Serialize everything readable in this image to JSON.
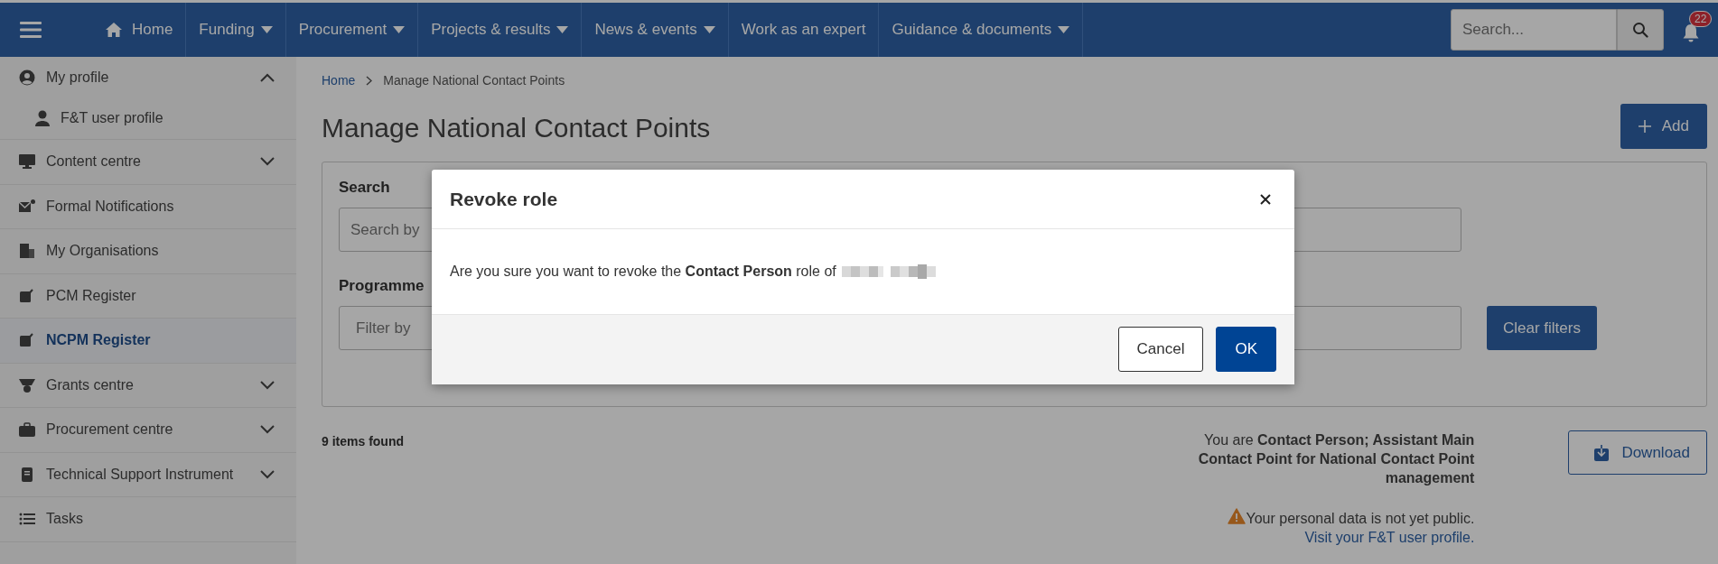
{
  "nav": {
    "items": [
      {
        "label": "Home",
        "kind": "home",
        "dropdown": false
      },
      {
        "label": "Funding",
        "kind": "link",
        "dropdown": true
      },
      {
        "label": "Procurement",
        "kind": "link",
        "dropdown": true
      },
      {
        "label": "Projects & results",
        "kind": "link",
        "dropdown": true
      },
      {
        "label": "News & events",
        "kind": "link",
        "dropdown": true
      },
      {
        "label": "Work as an expert",
        "kind": "link",
        "dropdown": false
      },
      {
        "label": "Guidance & documents",
        "kind": "link",
        "dropdown": true
      }
    ],
    "search": {
      "placeholder": "Search..."
    },
    "notifications": "22"
  },
  "sidebar": {
    "items": [
      {
        "label": "My profile",
        "kind": "group",
        "expanded": true,
        "selected": false,
        "children": [
          {
            "label": "F&T user profile",
            "selected": false
          }
        ]
      },
      {
        "label": "Content centre",
        "kind": "group",
        "expanded": false,
        "selected": false
      },
      {
        "label": "Formal Notifications",
        "kind": "link",
        "selected": false
      },
      {
        "label": "My Organisations",
        "kind": "link",
        "selected": false
      },
      {
        "label": "PCM Register",
        "kind": "link",
        "selected": false
      },
      {
        "label": "NCPM Register",
        "kind": "link",
        "selected": true
      },
      {
        "label": "Grants centre",
        "kind": "group",
        "expanded": false,
        "selected": false
      },
      {
        "label": "Procurement centre",
        "kind": "group",
        "expanded": false,
        "selected": false
      },
      {
        "label": "Technical Support Instrument",
        "kind": "group",
        "expanded": false,
        "selected": false
      },
      {
        "label": "Tasks",
        "kind": "link",
        "selected": false
      }
    ]
  },
  "breadcrumb": [
    "Home",
    "Manage National Contact Points"
  ],
  "page_title": "Manage National Contact Points",
  "add_button": "Add",
  "filters": {
    "search_label": "Search",
    "search_placeholder": "Search by",
    "programme_label": "Programme",
    "programme_placeholder": "Filter by",
    "clear_button": "Clear filters"
  },
  "results": {
    "count": "9 items found",
    "role_text": "You are **Contact Person; Assistant Main Contact Point for National Contact Point management**",
    "notice": "Your personal data is not yet public.",
    "notice_link": "Visit your F&T user profile.",
    "download_button": "Download"
  },
  "dialog": {
    "title": "Revoke role",
    "message": "Are you sure you want to revoke the **Contact Person** role of",
    "buttons": [
      {
        "label": "Cancel",
        "kind": "secondary"
      },
      {
        "label": "OK",
        "kind": "primary"
      }
    ]
  }
}
